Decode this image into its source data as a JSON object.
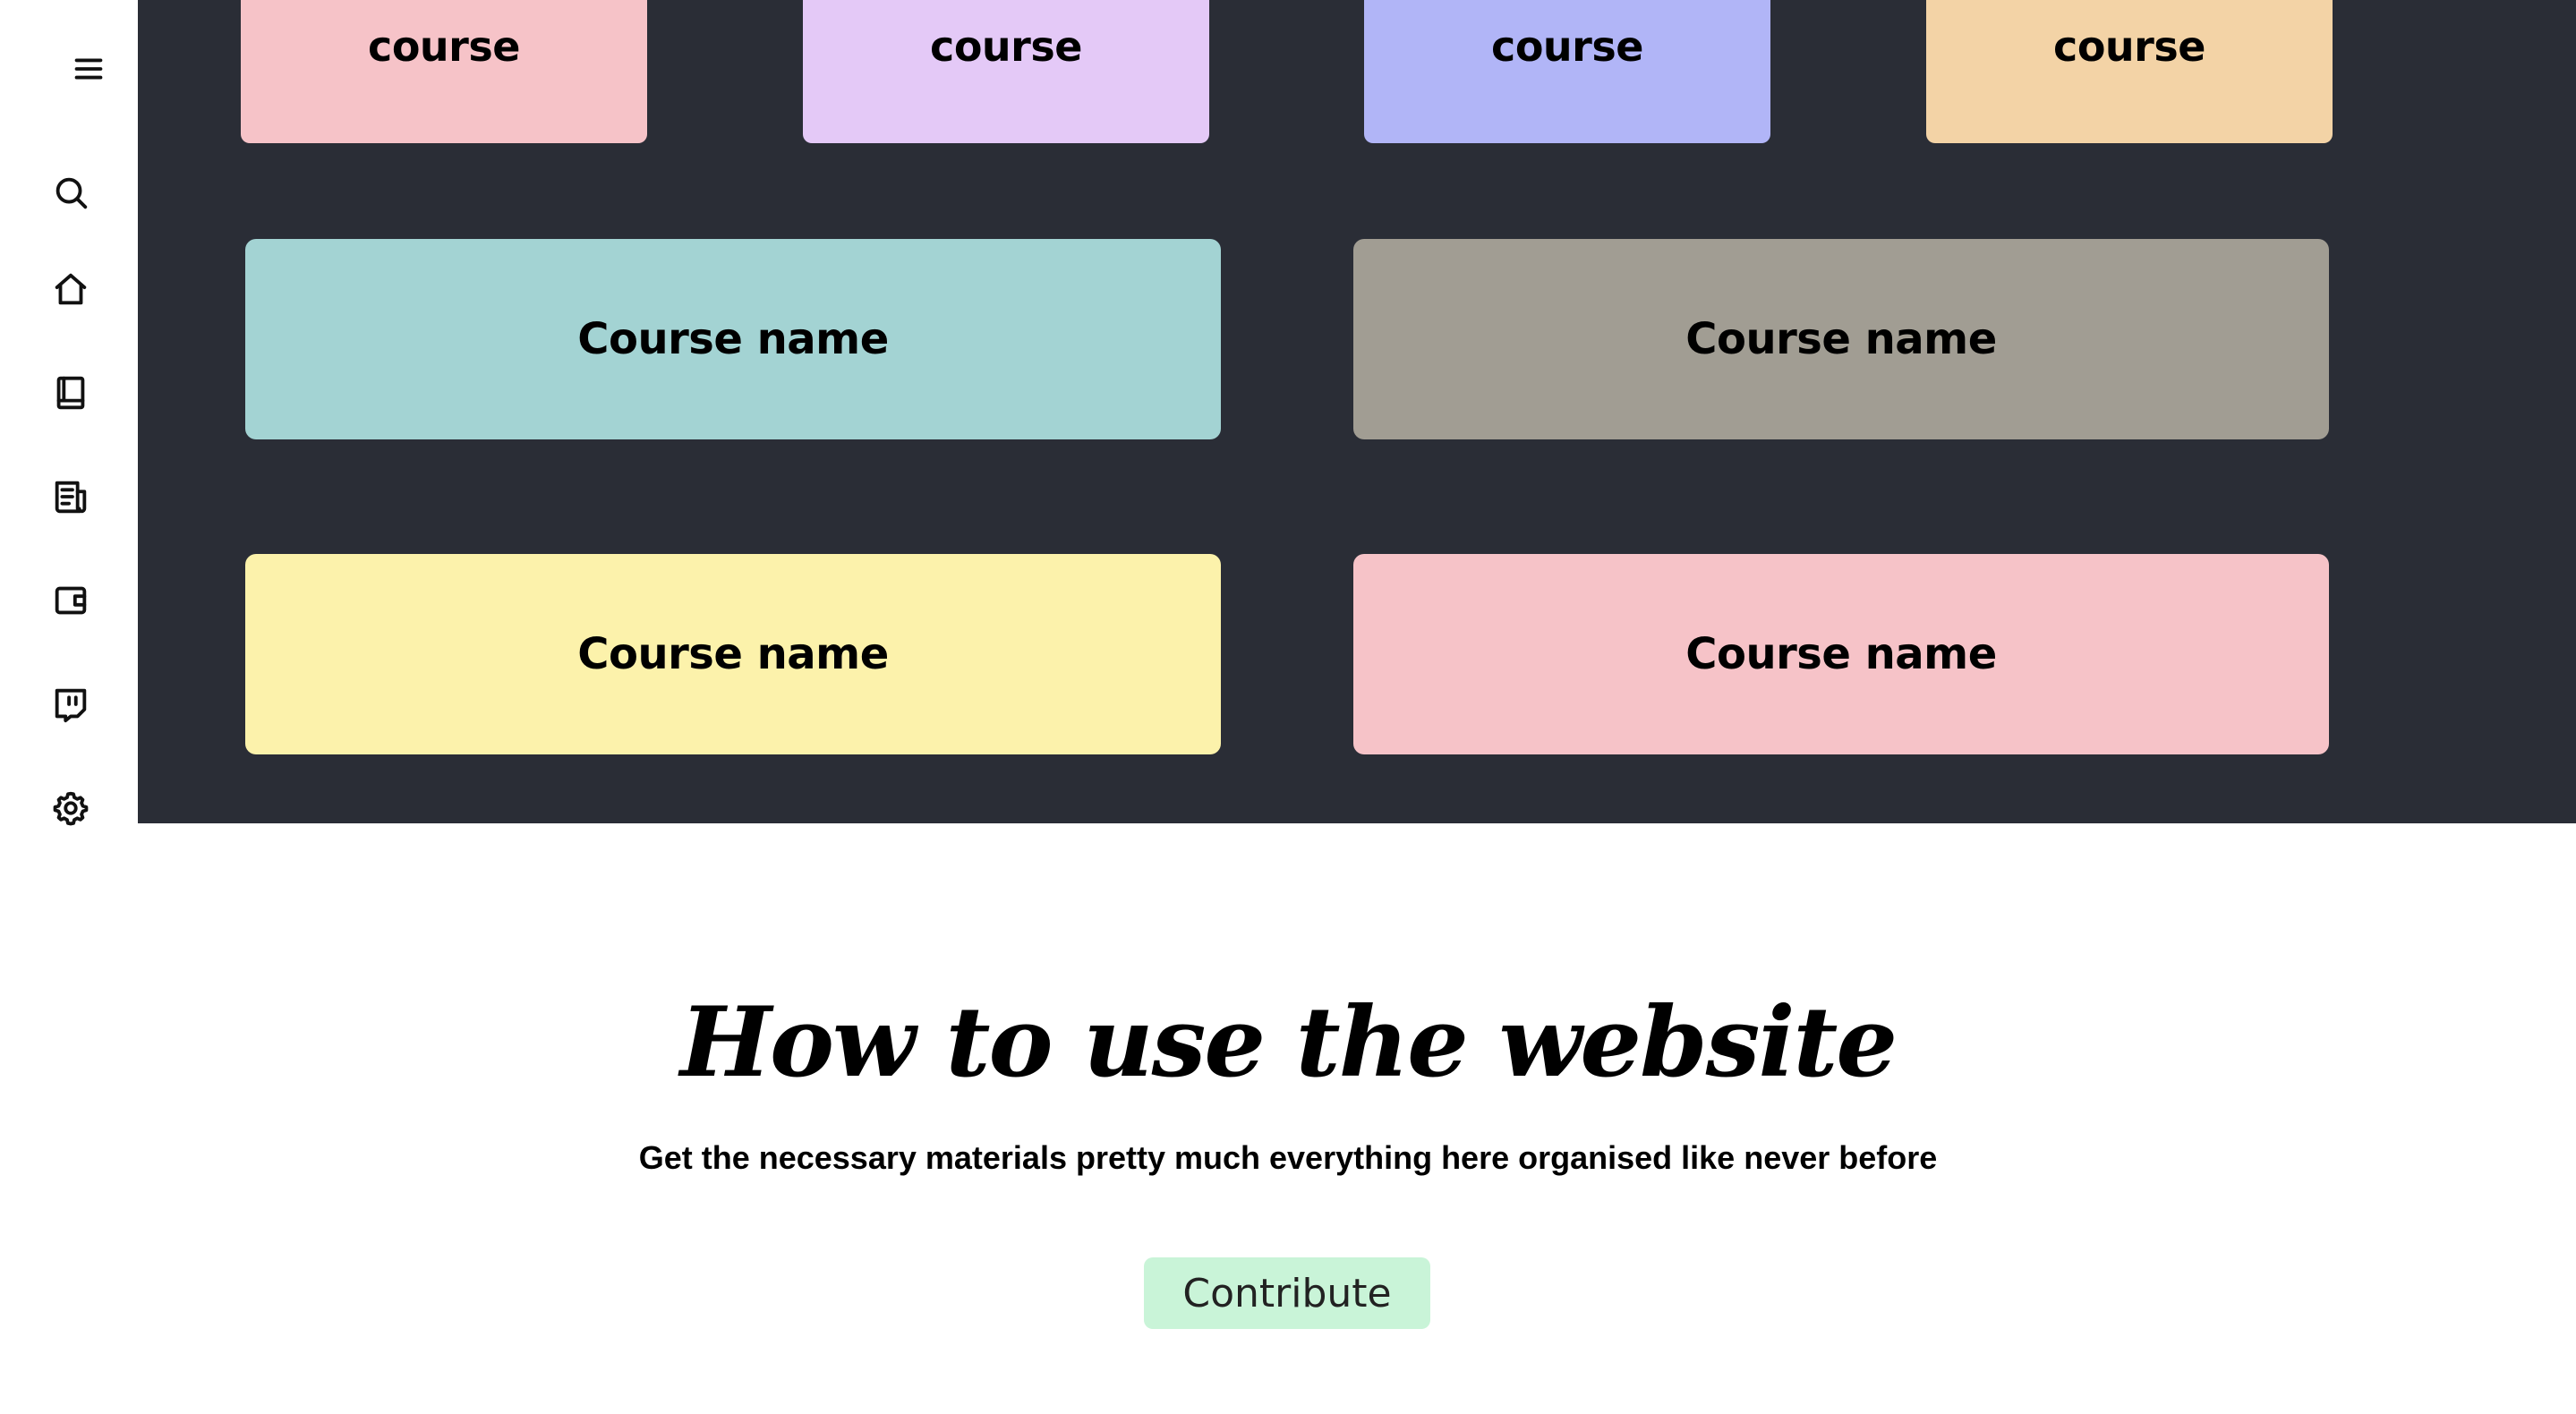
{
  "sidebar": {
    "items": [
      {
        "name": "menu-icon"
      },
      {
        "name": "search-icon"
      },
      {
        "name": "home-icon"
      },
      {
        "name": "book-icon"
      },
      {
        "name": "newspaper-icon"
      },
      {
        "name": "wallet-icon"
      },
      {
        "name": "chat-icon"
      },
      {
        "name": "gear-icon"
      }
    ]
  },
  "courses": {
    "small_cards": [
      {
        "label": "course",
        "color": "#f6c3c8"
      },
      {
        "label": "course",
        "color": "#e4c9f7"
      },
      {
        "label": "course",
        "color": "#b1b5f7"
      },
      {
        "label": "course",
        "color": "#f3d3a6"
      }
    ],
    "big_cards": [
      {
        "label": "Course name",
        "color": "#a3d3d3"
      },
      {
        "label": "Course name",
        "color": "#a19d93"
      },
      {
        "label": "Course name",
        "color": "#fcf2ab"
      },
      {
        "label": "Course name",
        "color": "#f6c3c8"
      }
    ],
    "background": "#2a2d36"
  },
  "howto": {
    "title": "How to use the website",
    "subtitle": "Get the necessary materials pretty much everything here organised like never before",
    "contribute_label": "Contribute",
    "contribute_color": "#c9f4d8"
  }
}
